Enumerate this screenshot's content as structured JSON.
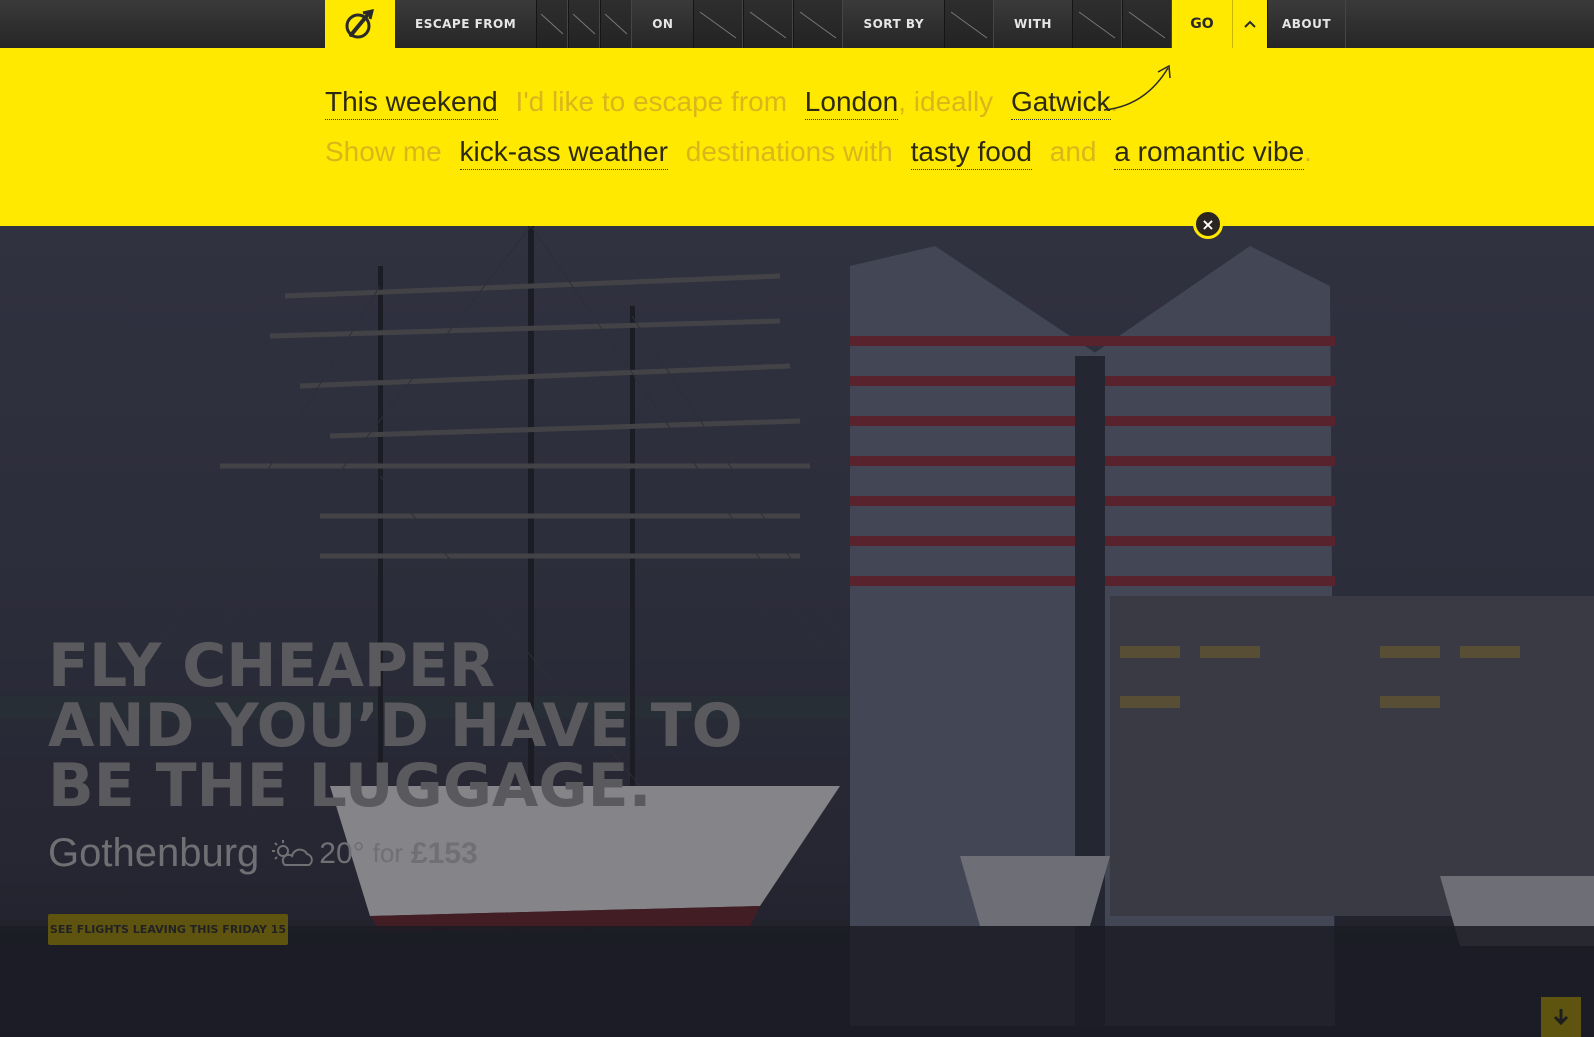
{
  "nav": {
    "escape_from": "ESCAPE FROM",
    "on": "ON",
    "sort_by": "SORT BY",
    "with": "WITH",
    "go": "GO",
    "about": "ABOUT"
  },
  "sentence": {
    "line1": {
      "when": "This weekend",
      "text1": "I'd like to escape from",
      "city": "London",
      "text2": ", ideally",
      "airport": "Gatwick",
      "end": "."
    },
    "line2": {
      "text1": "Show me",
      "sort": "kick-ass weather",
      "text2": "destinations with",
      "with1": "tasty food",
      "text3": "and",
      "with2": "a romantic vibe",
      "end": "."
    }
  },
  "close_label": "×",
  "hero": {
    "tagline": [
      "FLY CHEAPER",
      "AND YOU’D HAVE TO",
      "BE THE LUGGAGE."
    ],
    "destination": "Gothenburg",
    "weather_icon": "partly-cloudy-icon",
    "temperature": "20°",
    "for_label": "for",
    "price": "£153",
    "cta": "SEE FLIGHTS LEAVING THIS FRIDAY 15"
  },
  "colors": {
    "accent": "#ffe900",
    "nav_bg": "#2b2b2b",
    "muted_text": "#d8b71d"
  }
}
